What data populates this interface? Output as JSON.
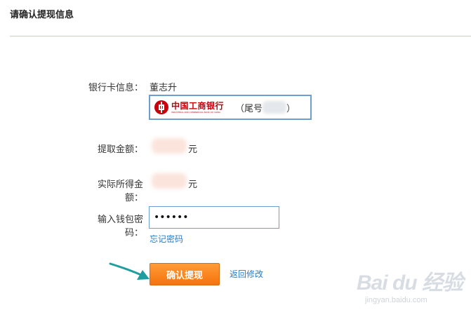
{
  "page": {
    "title": "请确认提现信息"
  },
  "form": {
    "bank_label": "银行卡信息：",
    "account_holder": "董志升",
    "bank_card": {
      "bank_name": "中国工商银行",
      "bank_name_en": "INDUSTRIAL AND COMMERCIAL BANK OF CHINA",
      "tail_prefix": "（尾号",
      "tail_suffix": "）",
      "brand_color": "#c7000b"
    },
    "withdraw_label": "提取金额：",
    "withdraw_unit": "元",
    "actual_label": "实际所得金额：",
    "actual_unit": "元",
    "password_label": "输入钱包密码：",
    "password_value": "123456",
    "forgot_link": "忘记密码"
  },
  "actions": {
    "confirm_label": "确认提现",
    "back_label": "返回修改",
    "confirm_color": "#f5730d",
    "link_color": "#2b7bc4"
  },
  "watermark": {
    "logo_text": "Bai du 经验",
    "site": "jingyan.baidu.com"
  }
}
